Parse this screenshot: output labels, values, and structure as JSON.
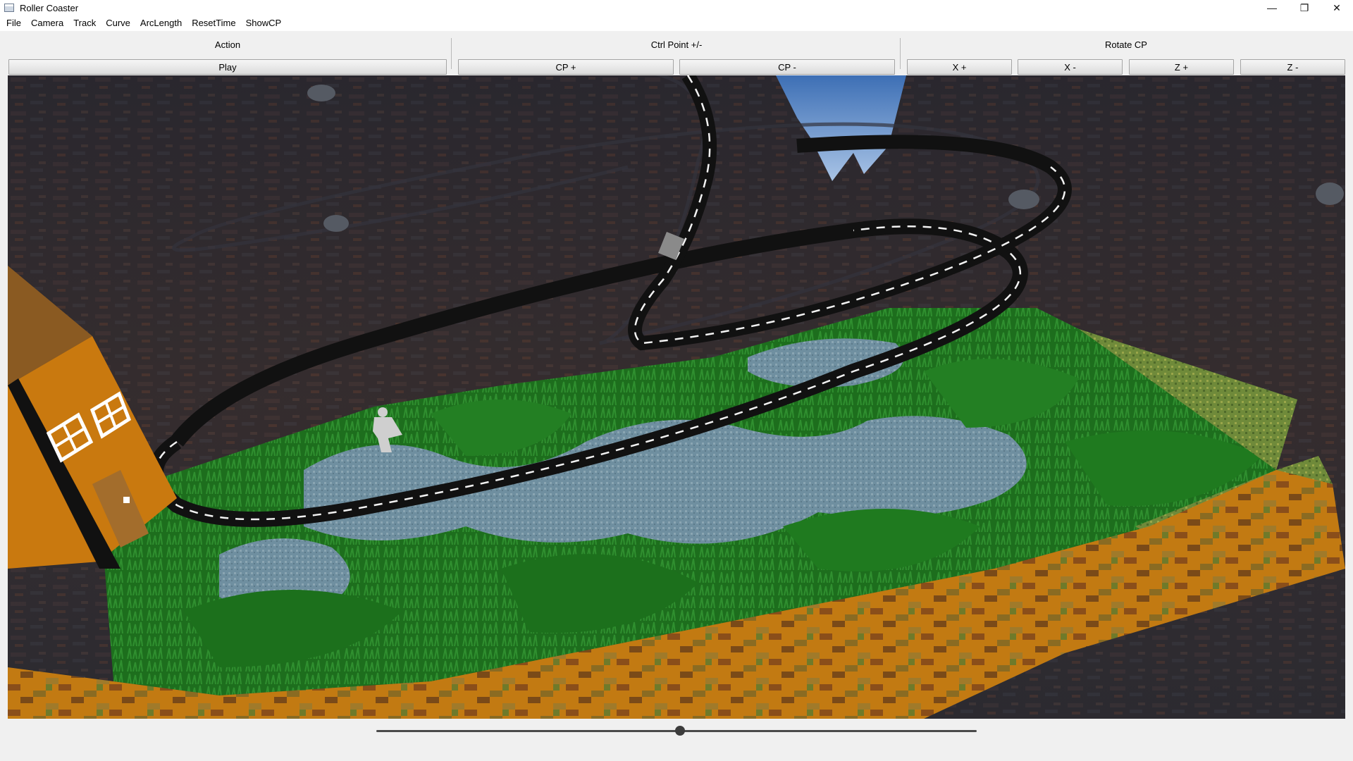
{
  "window": {
    "title": "Roller Coaster",
    "controls": {
      "minimize": "—",
      "restore": "❐",
      "close": "✕"
    }
  },
  "menu": {
    "items": [
      "File",
      "Camera",
      "Track",
      "Curve",
      "ArcLength",
      "ResetTime",
      "ShowCP"
    ]
  },
  "toolbar": {
    "action": {
      "title": "Action",
      "play": "Play"
    },
    "ctrl_point": {
      "title": "Ctrl Point +/-",
      "add": "CP +",
      "remove": "CP -"
    },
    "rotate_cp": {
      "title": "Rotate CP",
      "x_plus": "X +",
      "x_minus": "X -",
      "z_plus": "Z +",
      "z_minus": "Z -"
    }
  },
  "viewport": {
    "scene": "roller-coaster-3d-scene",
    "colors": {
      "sky": "#2e2a33",
      "grass": "#1f7a1f",
      "water": "#6f8fa0",
      "dirt": "#c47a14",
      "house": "#c9790f",
      "track": "#0d0d0d"
    }
  },
  "slider": {
    "value": 0.506
  }
}
